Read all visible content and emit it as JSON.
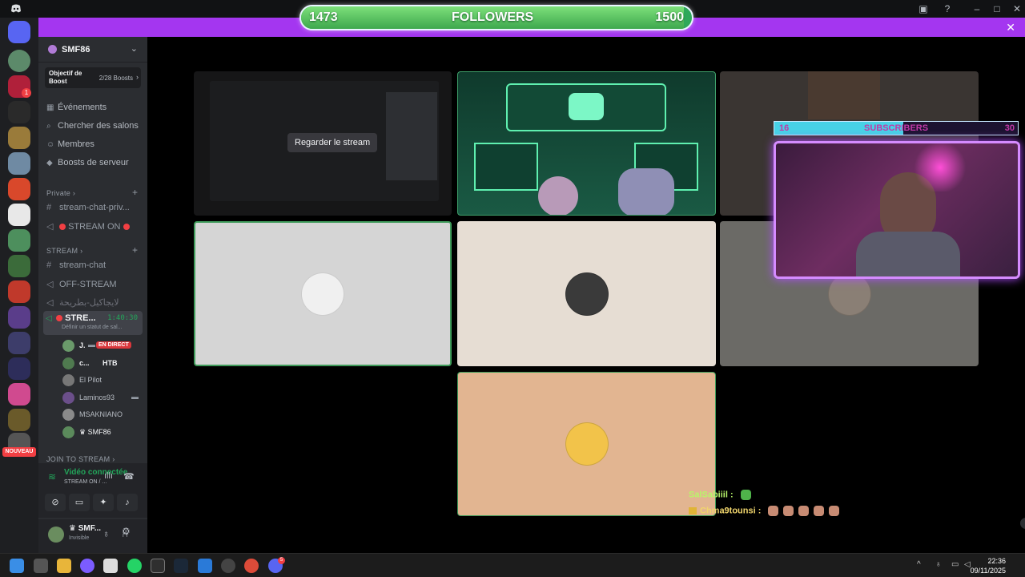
{
  "overlay": {
    "followers_current": "1473",
    "followers_label": "FOLLOWERS",
    "followers_goal": "1500",
    "followers_progress": 0.98,
    "subs_current": "16",
    "subs_label": "SUBSCRIBERS",
    "subs_goal": "30",
    "subs_progress": 0.53
  },
  "server": {
    "name": "SMF86",
    "boost_label": "Objectif de Boost",
    "boost_count": "2/28 Boosts"
  },
  "menu": [
    "Événements",
    "Chercher des salons",
    "Membres",
    "Boosts de serveur"
  ],
  "categories": {
    "private": "Private",
    "stream": "STREAM",
    "join": "JOIN TO STREAM"
  },
  "channels": {
    "stream_chat_private": "stream-chat-priv...",
    "stream_on": "STREAM ON",
    "stream_chat": "stream-chat",
    "off_stream": "OFF-STREAM",
    "arabic": "لايجاكيل-بطريحة",
    "live_name": "STRE...",
    "live_timer": "1:40:30",
    "live_status": "Définir un statut de sal..."
  },
  "members": [
    {
      "name": "J.",
      "badge": "EN DIRECT"
    },
    {
      "name": "c...",
      "tag": "HTB"
    },
    {
      "name": "El Pilot"
    },
    {
      "name": "Laminos93"
    },
    {
      "name": "MSAKNIANO"
    },
    {
      "name": "SMF86"
    }
  ],
  "voice": {
    "connected": "Vidéo connectée",
    "channel": "STREAM ON / ..."
  },
  "user": {
    "name": "SMF...",
    "status": "Invisible"
  },
  "rail": {
    "badge_count": "1",
    "new_label": "NOUVEAU"
  },
  "grid": {
    "watch_label": "Regarder le stream"
  },
  "chat": [
    {
      "user": "SalSabiiil :",
      "color": "#b8f56a"
    },
    {
      "user": "Chma9tounsi :",
      "color": "#f0d56c"
    }
  ],
  "taskbar": {
    "time": "22:36",
    "date": "09/11/2025",
    "discord_badge": "5"
  },
  "colors": {
    "overlay_bar": "#a436f0",
    "live": "#da373c",
    "connected": "#23a55a"
  }
}
